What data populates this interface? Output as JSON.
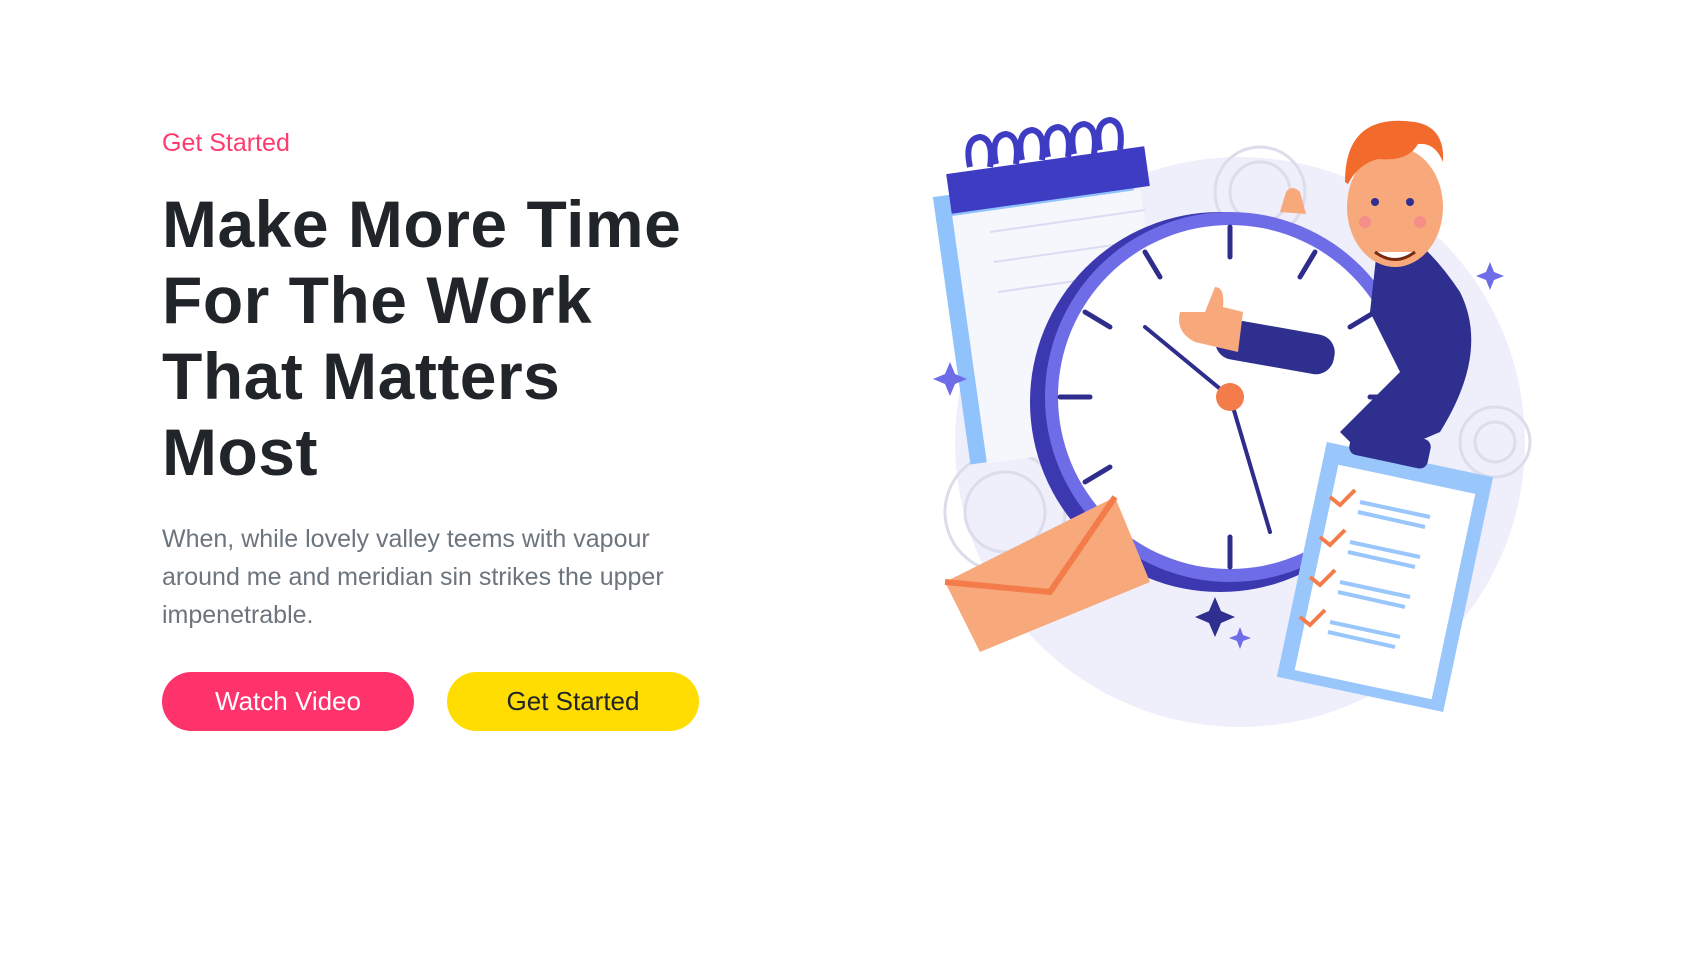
{
  "hero": {
    "eyebrow": "Get Started",
    "title_lines": [
      "Make More Time",
      "For The Work",
      "That Matters",
      "Most"
    ],
    "description": "When, while lovely valley teems with vapour around me and meridian sin strikes the upper impenetrable.",
    "buttons": {
      "watch_video": "Watch Video",
      "get_started": "Get Started"
    }
  },
  "colors": {
    "accent_pink": "#ff336b",
    "accent_yellow": "#ffdd00",
    "heading": "#212529",
    "body_text": "#6c757d",
    "illustration_purple": "#6f6ce8",
    "illustration_orange": "#f47b4a"
  },
  "illustration": {
    "icons": [
      "clock-icon",
      "calendar-icon",
      "envelope-icon",
      "clipboard-checklist-icon",
      "gear-icon",
      "sparkle-icon",
      "person-thumbs-up"
    ]
  }
}
